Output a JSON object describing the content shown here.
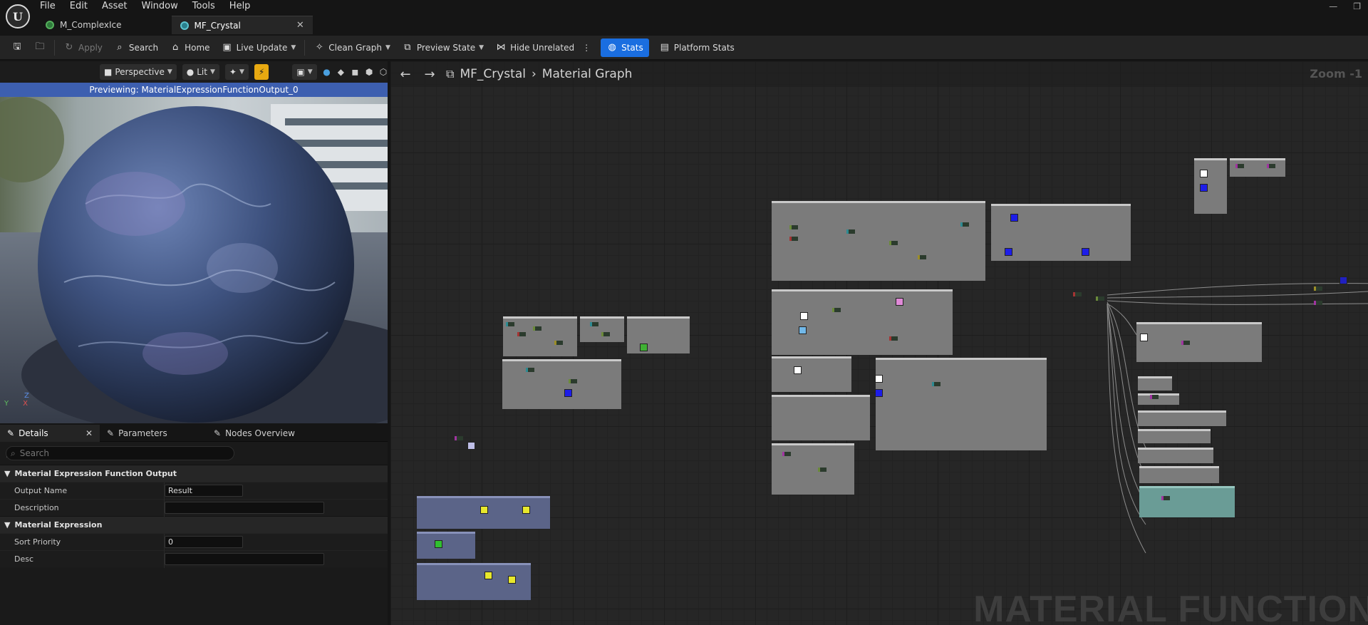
{
  "app": {
    "menu": [
      "File",
      "Edit",
      "Asset",
      "Window",
      "Tools",
      "Help"
    ],
    "tabs": [
      {
        "label": "M_ComplexIce",
        "active": false
      },
      {
        "label": "MF_Crystal",
        "active": true
      }
    ]
  },
  "toolbar": {
    "apply": "Apply",
    "search": "Search",
    "home": "Home",
    "live_update": "Live Update",
    "clean_graph": "Clean Graph",
    "preview_state": "Preview State",
    "hide_unrelated": "Hide Unrelated",
    "stats": "Stats",
    "platform_stats": "Platform Stats"
  },
  "viewport": {
    "perspective": "Perspective",
    "lit": "Lit",
    "preview_label": "Previewing: MaterialExpressionFunctionOutput_0",
    "axis": {
      "z": "Z",
      "y": "Y",
      "x": "X"
    }
  },
  "details": {
    "tabs": [
      "Details",
      "Parameters",
      "Nodes Overview"
    ],
    "search_placeholder": "Search",
    "sections": [
      {
        "title": "Material Expression Function Output",
        "rows": [
          {
            "label": "Output Name",
            "value": "Result"
          },
          {
            "label": "Description",
            "value": ""
          }
        ]
      },
      {
        "title": "Material Expression",
        "rows": [
          {
            "label": "Sort Priority",
            "value": "0"
          },
          {
            "label": "Desc",
            "value": ""
          }
        ]
      }
    ]
  },
  "graph": {
    "breadcrumb": [
      "MF_Crystal",
      "Material Graph"
    ],
    "zoom": "Zoom -1",
    "watermark": "MATERIAL FUNCTION"
  },
  "colors": {
    "accent": "#1a6ee0",
    "preview_bar": "#3d5fb0",
    "comment_gray": "#7b7b7b",
    "comment_blue": "#5b6488",
    "comment_teal": "#6a9c96"
  }
}
